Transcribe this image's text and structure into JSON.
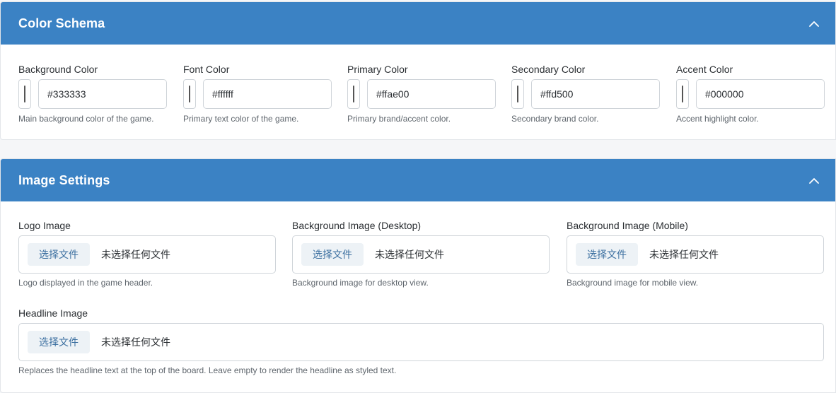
{
  "color_schema": {
    "title": "Color Schema",
    "fields": [
      {
        "label": "Background Color",
        "value": "#333333",
        "help": "Main background color of the game."
      },
      {
        "label": "Font Color",
        "value": "#ffffff",
        "help": "Primary text color of the game."
      },
      {
        "label": "Primary Color",
        "value": "#ffae00",
        "help": "Primary brand/accent color."
      },
      {
        "label": "Secondary Color",
        "value": "#ffd500",
        "help": "Secondary brand color."
      },
      {
        "label": "Accent Color",
        "value": "#000000",
        "help": "Accent highlight color."
      }
    ]
  },
  "image_settings": {
    "title": "Image Settings",
    "fields": [
      {
        "label": "Logo Image",
        "button": "选择文件",
        "status": "未选择任何文件",
        "help": "Logo displayed in the game header."
      },
      {
        "label": "Background Image (Desktop)",
        "button": "选择文件",
        "status": "未选择任何文件",
        "help": "Background image for desktop view."
      },
      {
        "label": "Background Image (Mobile)",
        "button": "选择文件",
        "status": "未选择任何文件",
        "help": "Background image for mobile view."
      },
      {
        "label": "Headline Image",
        "button": "选择文件",
        "status": "未选择任何文件",
        "help": "Replaces the headline text at the top of the board. Leave empty to render the headline as styled text."
      }
    ]
  },
  "icons": {
    "collapse": "chevron-up-icon"
  },
  "colors": {
    "header_bg": "#3b82c4",
    "header_text": "#ffffff",
    "file_button_text": "#3b6fa0"
  }
}
